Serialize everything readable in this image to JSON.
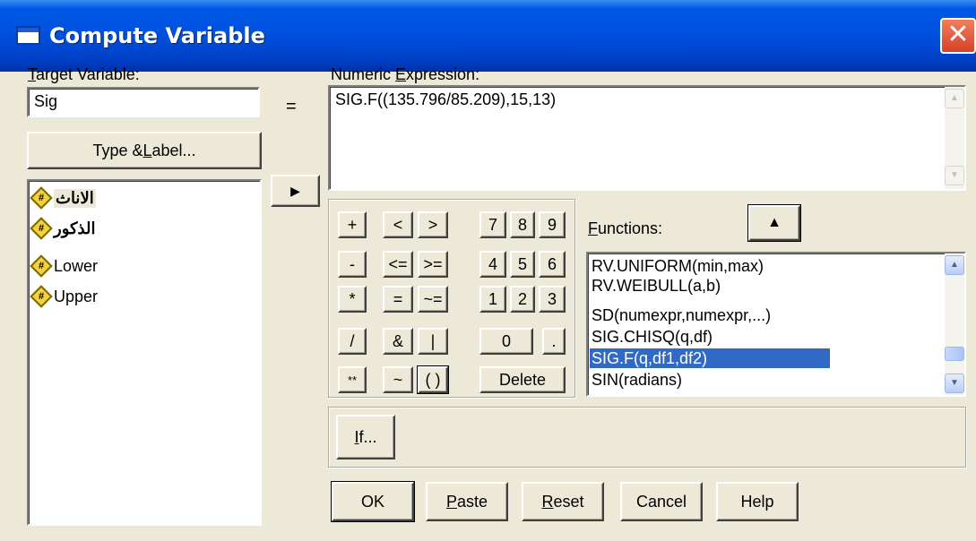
{
  "window": {
    "title": "Compute Variable",
    "close": "✕"
  },
  "target": {
    "label_pre": "",
    "label_ul": "T",
    "label_post": "arget Variable:",
    "value": "Sig"
  },
  "equals": "=",
  "type_label_button": {
    "pre": "Type & ",
    "ul": "L",
    "post": "abel..."
  },
  "variables": [
    {
      "name": "الاناث",
      "bold": true
    },
    {
      "name": "الذكور",
      "bold": true
    },
    {
      "name": "Lower",
      "bold": false
    },
    {
      "name": "Upper",
      "bold": false
    }
  ],
  "expression": {
    "label_pre": "Numeric ",
    "label_ul": "E",
    "label_post": "xpression:",
    "value": "SIG.F((135.796/85.209),15,13)"
  },
  "move_arrow": "▶",
  "keypad": [
    [
      "+",
      "<",
      ">",
      "7",
      "8",
      "9"
    ],
    [
      "-",
      "<=",
      ">=",
      "4",
      "5",
      "6"
    ],
    [
      "*",
      "=",
      "~=",
      "1",
      "2",
      "3"
    ],
    [
      "/",
      "&",
      "|",
      "0",
      "."
    ],
    [
      "**",
      "~",
      "( )",
      "Delete"
    ]
  ],
  "functions": {
    "label_ul": "F",
    "label_post": "unctions:",
    "up_button": "▲",
    "items": [
      "RV.UNIFORM(min,max)",
      "RV.WEIBULL(a,b)",
      "SD(numexpr,numexpr,...)",
      "SIG.CHISQ(q,df)",
      "SIG.F(q,df1,df2)",
      "SIN(radians)"
    ],
    "selected_index": 4
  },
  "if_button": {
    "ul": "I",
    "post": "f..."
  },
  "bottom_buttons": {
    "ok": "OK",
    "paste_ul": "P",
    "paste_post": "aste",
    "reset_ul": "R",
    "reset_post": "eset",
    "cancel": "Cancel",
    "help": "Help"
  },
  "colors": {
    "title_bar": "#0054e3",
    "dialog_bg": "#ece9d8",
    "selection": "#316ac5",
    "close": "#e0583a"
  }
}
